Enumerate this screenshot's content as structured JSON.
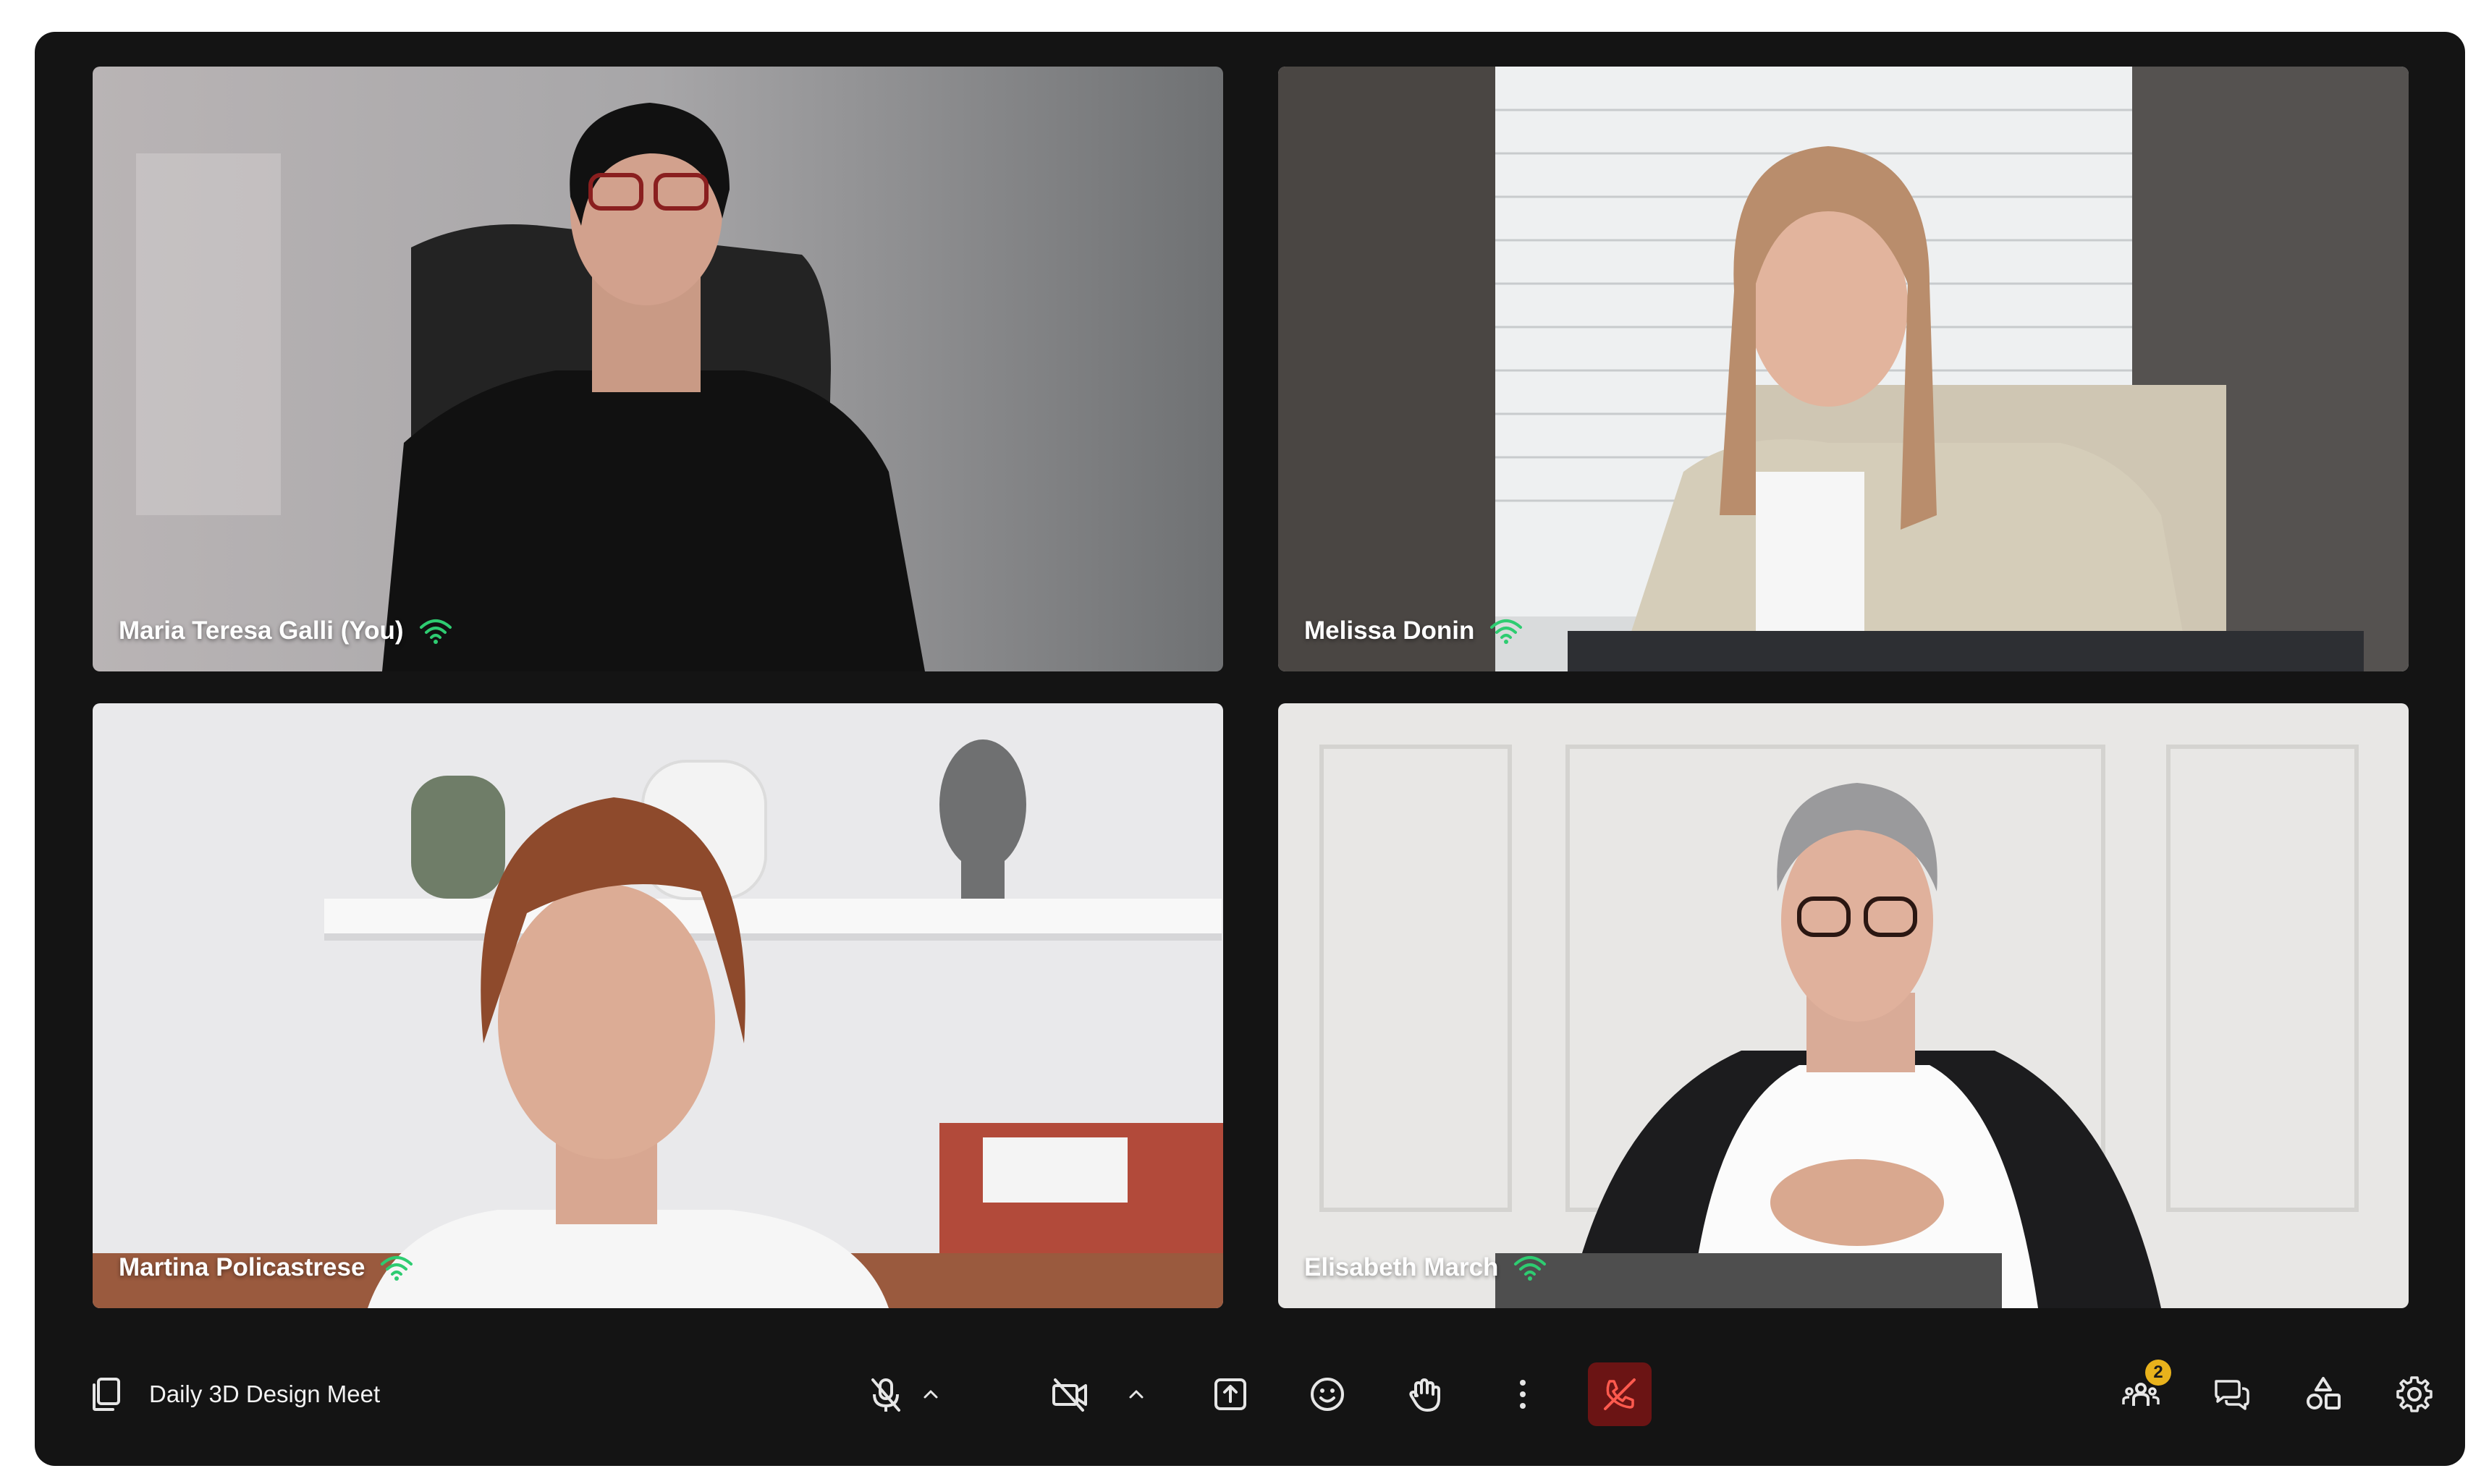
{
  "meeting": {
    "title": "Daily 3D Design Meet"
  },
  "participants": [
    {
      "name": "Maria Teresa Galli (You)",
      "signal_color": "#2ecc71"
    },
    {
      "name": "Melissa Donin",
      "signal_color": "#2ecc71"
    },
    {
      "name": "Martina Policastrese",
      "signal_color": "#2ecc71"
    },
    {
      "name": "Elisabeth March",
      "signal_color": "#2ecc71"
    }
  ],
  "toolbar": {
    "copy_icon": "copy-icon",
    "mic_icon": "mic-off-icon",
    "camera_icon": "camera-off-icon",
    "share_icon": "share-screen-icon",
    "reactions_icon": "emoji-icon",
    "raise_hand_icon": "hand-icon",
    "more_icon": "more-vertical-icon",
    "leave_icon": "phone-off-icon",
    "participants_icon": "people-icon",
    "participants_badge": "2",
    "chat_icon": "chat-icon",
    "apps_icon": "shapes-icon",
    "settings_icon": "gear-icon"
  },
  "colors": {
    "background": "#141414",
    "leave_button": "#6b1414",
    "badge": "#e8b21c",
    "signal": "#2ecc71"
  }
}
